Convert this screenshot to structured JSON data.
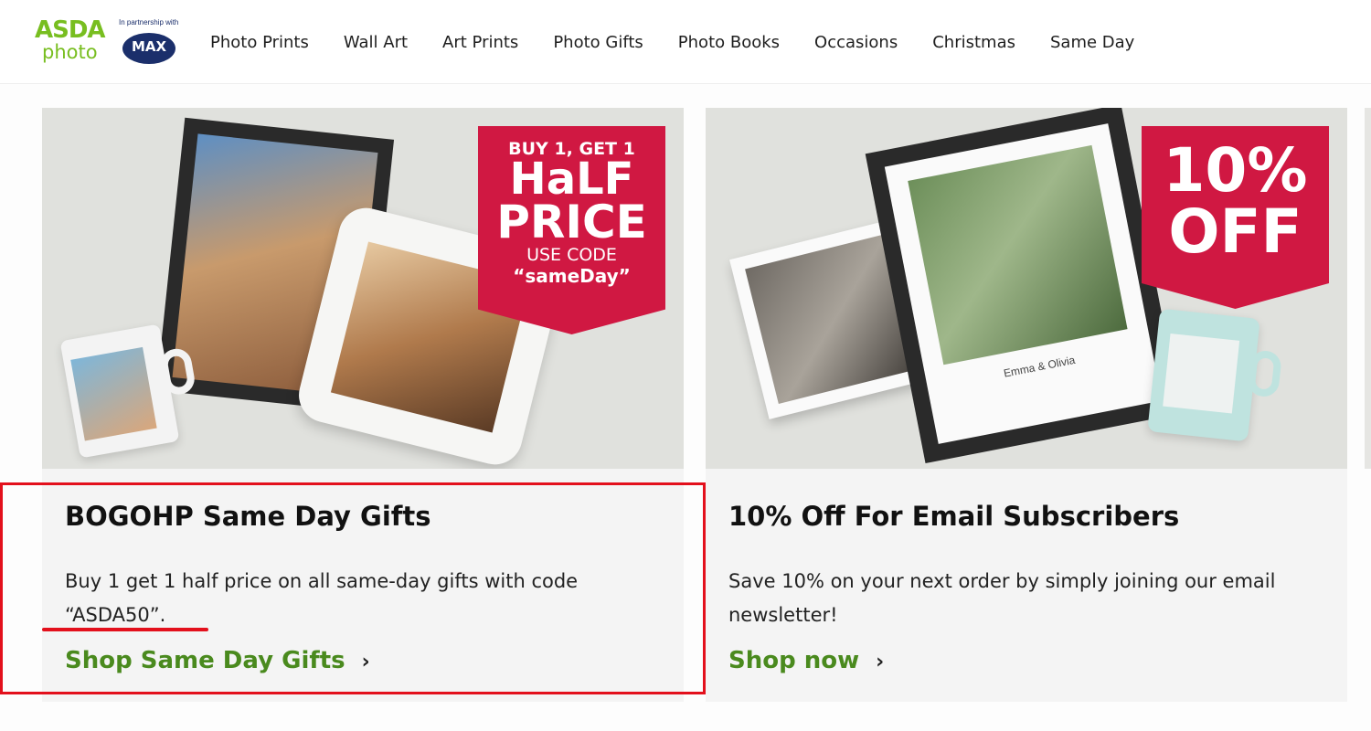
{
  "header": {
    "logo_top": "ASDA",
    "logo_bottom": "photo",
    "partner_text": "In partnership with",
    "partner_logo": "MAX",
    "nav": [
      "Photo Prints",
      "Wall Art",
      "Art Prints",
      "Photo Gifts",
      "Photo Books",
      "Occasions",
      "Christmas",
      "Same Day"
    ]
  },
  "cards": [
    {
      "banner_line1": "BUY 1, GET 1",
      "banner_line2": "HaLF",
      "banner_line3": "PRICE",
      "banner_line4": "USE CODE",
      "banner_line5": "“sameDay”",
      "title": "BOGOHP Same Day Gifts",
      "description": "Buy 1 get 1 half price on all same-day gifts with code “ASDA50”.",
      "cta": "Shop Same Day Gifts"
    },
    {
      "banner_line1": "10%",
      "banner_line2": "OFF",
      "poster_caption": "Emma & Olivia",
      "title": "10% Off For Email Subscribers",
      "description": "Save 10% on your next order by simply joining our email newsletter!",
      "cta": "Shop now"
    }
  ],
  "colors": {
    "brand_green": "#78be20",
    "cta_green": "#4a8a1e",
    "banner_red": "#d01842",
    "highlight_red": "#e3101c"
  }
}
